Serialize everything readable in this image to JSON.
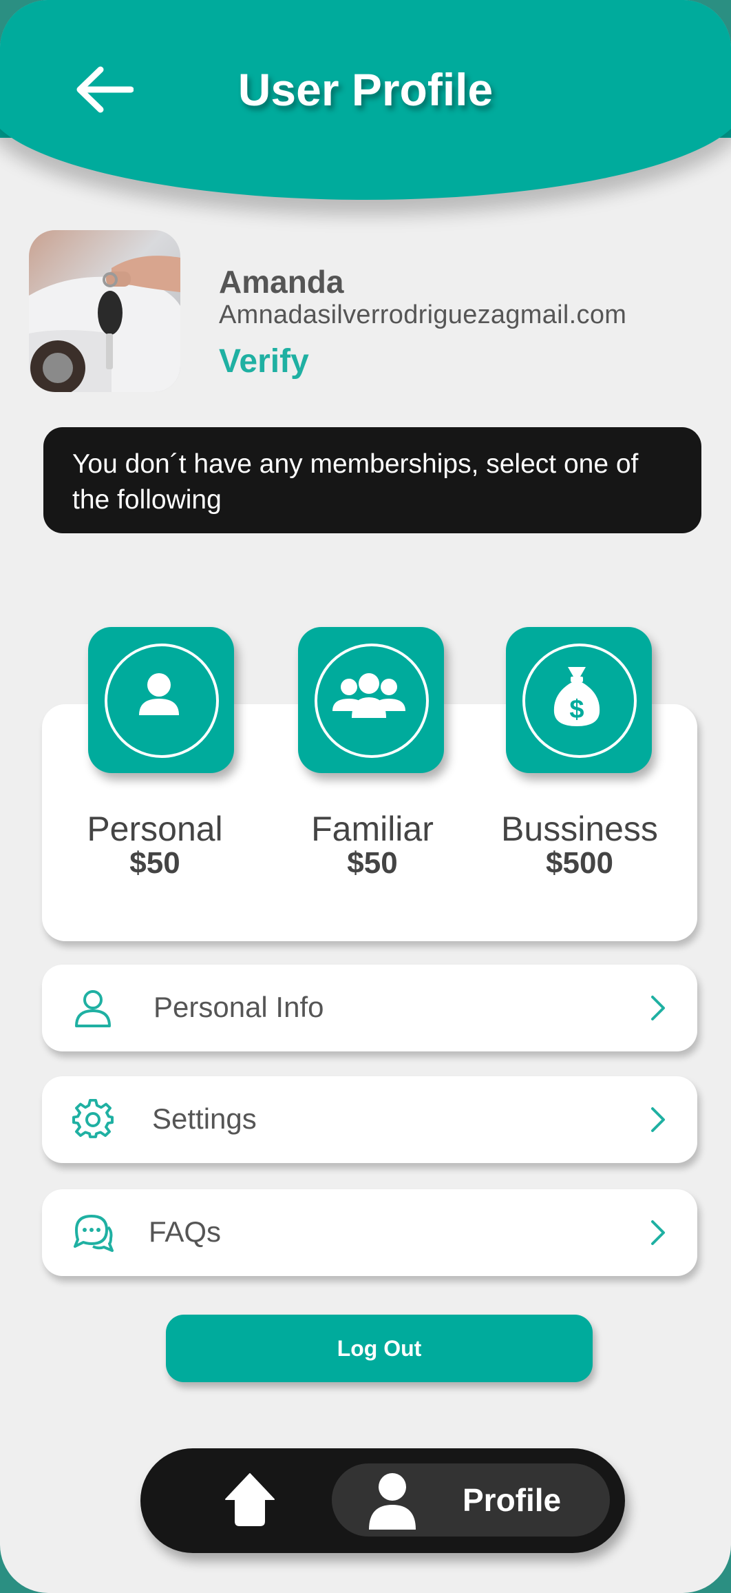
{
  "header": {
    "title": "User Profile",
    "back_icon": "arrow-left-icon"
  },
  "user": {
    "name": "Amanda",
    "email": "Amnadasilverrodriguezagmail.com",
    "verify_label": "Verify",
    "avatar_description": "photo-avatar"
  },
  "notice": {
    "text": "You don´t have any memberships, select one of the following"
  },
  "plans": [
    {
      "name": "Personal",
      "price": "$50",
      "icon": "person-icon"
    },
    {
      "name": "Familiar",
      "price": "$50",
      "icon": "group-icon"
    },
    {
      "name": "Bussiness",
      "price": "$500",
      "icon": "money-bag-icon"
    }
  ],
  "menu": [
    {
      "label": "Personal Info",
      "icon": "user-outline-icon"
    },
    {
      "label": "Settings",
      "icon": "gear-icon"
    },
    {
      "label": "FAQs",
      "icon": "chat-bubbles-icon"
    }
  ],
  "logout_label": "Log Out",
  "bottom_nav": {
    "home_icon": "home-icon",
    "profile_label": "Profile",
    "profile_icon": "person-icon"
  },
  "colors": {
    "accent": "#00ab9c",
    "dark": "#161616",
    "background": "#efefef"
  }
}
